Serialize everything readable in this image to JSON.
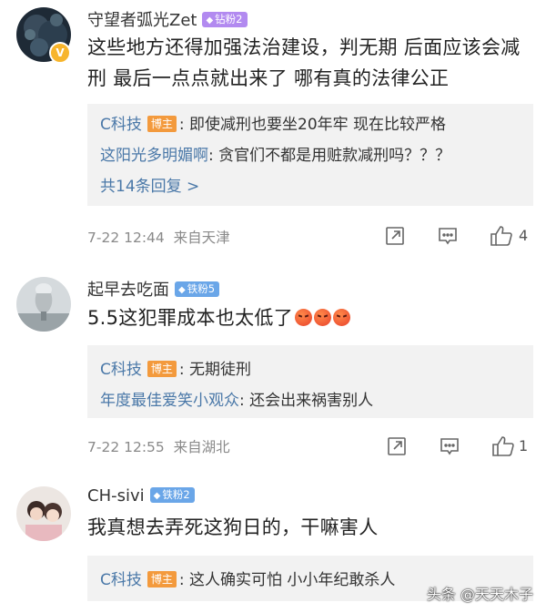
{
  "comments": [
    {
      "username": "守望者弧光Zet",
      "badge": "钻粉2",
      "content": "这些地方还得加强法治建设，判无期 后面应该会减刑 最后一点点就出来了 哪有真的法律公正",
      "replies": [
        {
          "name": "C科技",
          "is_host": true,
          "host_label": "博主",
          "text": ": 即使减刑也要坐20年牢 现在比较严格"
        },
        {
          "name": "这阳光多明媚啊",
          "is_host": false,
          "text": ": 贪官们不都是用赃款减刑吗？？？"
        }
      ],
      "more_replies": "共14条回复 >",
      "time": "7-22 12:44",
      "source": "来自天津",
      "like_count": "4"
    },
    {
      "username": "起早去吃面",
      "badge": "铁粉5",
      "content": "5.5这犯罪成本也太低了",
      "replies": [
        {
          "name": "C科技",
          "is_host": true,
          "host_label": "博主",
          "text": ": 无期徒刑"
        },
        {
          "name": "年度最佳爱笑小观众",
          "is_host": false,
          "text": ": 还会出来祸害别人"
        }
      ],
      "time": "7-22 12:55",
      "source": "来自湖北",
      "like_count": "1"
    },
    {
      "username": "CH-sivi",
      "badge": "铁粉2",
      "content": "我真想去弄死这狗日的，干嘛害人",
      "replies": [
        {
          "name": "C科技",
          "is_host": true,
          "host_label": "博主",
          "text": ": 这人确实可怕 小小年纪敢杀人"
        }
      ]
    }
  ],
  "icons": {
    "badge_diamond": "diamond-icon",
    "badge_iron": "iron-icon",
    "share": "share-icon",
    "comment": "comment-icon",
    "like": "thumbs-up-icon",
    "vip": "vip-icon"
  },
  "colors": {
    "link": "#4a78a8",
    "host_badge": "#f39a3d",
    "diamond_badge": "#b28af0",
    "iron_badge": "#6aa6e8",
    "reply_bg": "#f2f2f2",
    "meta": "#8a8a8a"
  },
  "watermark": "头条 @天天木子"
}
